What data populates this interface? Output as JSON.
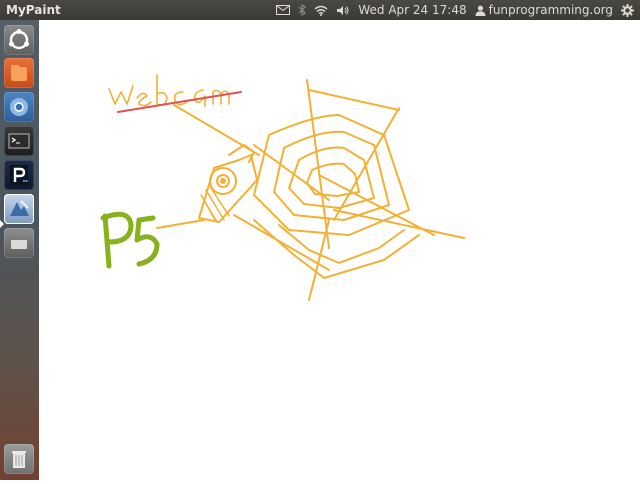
{
  "app": {
    "title": "MyPaint"
  },
  "panel": {
    "datetime": "Wed Apr 24 17:48",
    "user": "funprogramming.org"
  },
  "launcher": {
    "items": [
      {
        "name": "dash-icon"
      },
      {
        "name": "files-icon"
      },
      {
        "name": "chromium-icon"
      },
      {
        "name": "terminal-icon"
      },
      {
        "name": "processing-icon"
      },
      {
        "name": "mypaint-icon"
      },
      {
        "name": "window-icon"
      },
      {
        "name": "trash-icon"
      }
    ]
  },
  "canvas": {
    "annotations": {
      "webcam_label": "webcam",
      "p5_label": "P5"
    },
    "colors": {
      "orange": "#f2b134",
      "red": "#e05050",
      "green": "#86b21c"
    }
  }
}
